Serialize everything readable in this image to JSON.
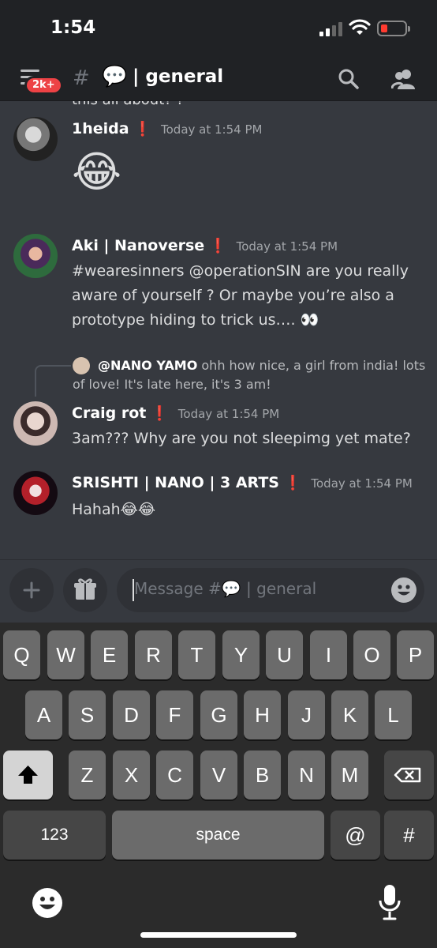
{
  "status_bar": {
    "time": "1:54"
  },
  "header": {
    "badge": "2k+",
    "channel_emoji": "💬",
    "channel_name": "| general",
    "colors": {
      "background": "#202225",
      "badge": "#ed4245"
    }
  },
  "messages": {
    "cut_off_text": "this all about? ?",
    "items": [
      {
        "author": "1heida",
        "flag": "❗",
        "timestamp": "Today at 1:54 PM",
        "emoji": "😂"
      },
      {
        "author": "Aki | Nanoverse",
        "flag": "❗",
        "timestamp": "Today at 1:54 PM",
        "text": "#wearesinners @operationSIN are you really aware of yourself ? Or maybe you’re also a prototype hiding to trick us…. 👀"
      },
      {
        "author": "Craig rot",
        "flag": "❗",
        "timestamp": "Today at 1:54 PM",
        "reply_author": "@NANO YAMO",
        "reply_text": "ohh how nice, a girl from india! lots of love! It's late here, it's 3 am!",
        "text": "3am??? Why are you not sleepimg yet mate?"
      },
      {
        "author": "SRISHTI | NANO | 3 ARTS",
        "flag": "❗",
        "timestamp": "Today at 1:54 PM",
        "text": "Hahah😂😂"
      }
    ]
  },
  "composer": {
    "placeholder": "Message #💬 | general",
    "add_icon": "plus-icon",
    "gift_icon": "gift-icon",
    "emoji_icon": "smile-icon"
  },
  "keyboard": {
    "row1": [
      "Q",
      "W",
      "E",
      "R",
      "T",
      "Y",
      "U",
      "I",
      "O",
      "P"
    ],
    "row2": [
      "A",
      "S",
      "D",
      "F",
      "G",
      "H",
      "J",
      "K",
      "L"
    ],
    "row3": [
      "Z",
      "X",
      "C",
      "V",
      "B",
      "N",
      "M"
    ],
    "num_label": "123",
    "space_label": "space",
    "at_label": "@",
    "hash_label": "#",
    "shift_icon": "shift-icon",
    "backspace_icon": "backspace-icon",
    "emoji_icon": "emoji-icon",
    "mic_icon": "microphone-icon"
  }
}
